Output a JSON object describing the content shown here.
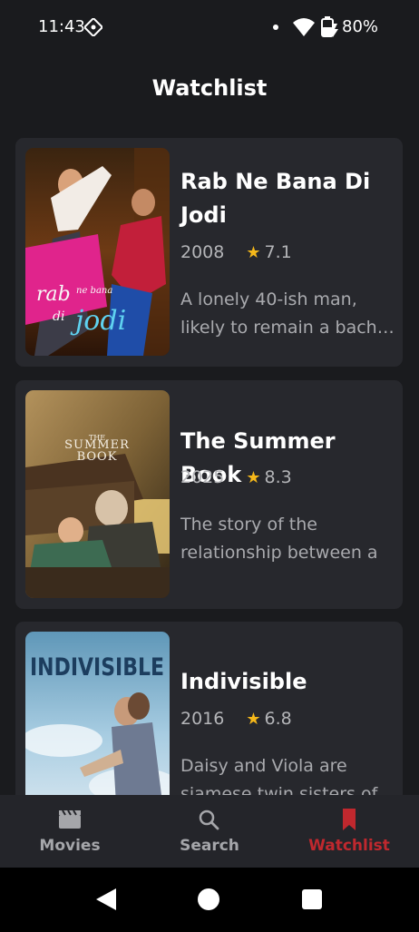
{
  "status_bar": {
    "time": "11:43",
    "battery": "80%"
  },
  "header": {
    "title": "Watchlist"
  },
  "movies": [
    {
      "title_lines": [
        "Rab Ne Bana Di",
        "Jodi"
      ],
      "year": "2008",
      "rating": "7.1",
      "description_lines": [
        "A lonely 40-ish man,",
        "likely to remain a bachelor"
      ],
      "poster_text": [
        "rab ne bana",
        "di jodi"
      ]
    },
    {
      "title_lines": [
        "The Summer Book"
      ],
      "year": "2025",
      "rating": "8.3",
      "description_lines": [
        "The story of the",
        "relationship between a"
      ],
      "poster_text": [
        "THE",
        "SUMMER",
        "BOOK"
      ]
    },
    {
      "title_lines": [
        "Indivisible"
      ],
      "year": "2016",
      "rating": "6.8",
      "description_lines": [
        "Daisy and Viola are",
        "siamese twin sisters of"
      ],
      "poster_text": [
        "INDIVISIBLE"
      ]
    }
  ],
  "bottom_nav": {
    "items": [
      {
        "label": "Movies",
        "icon": "clapperboard-icon"
      },
      {
        "label": "Search",
        "icon": "search-icon"
      },
      {
        "label": "Watchlist",
        "icon": "bookmark-icon",
        "active": true
      }
    ]
  },
  "colors": {
    "background": "#1a1b1e",
    "card": "#27282d",
    "accent": "#c0282e",
    "star": "#f5b81a"
  }
}
